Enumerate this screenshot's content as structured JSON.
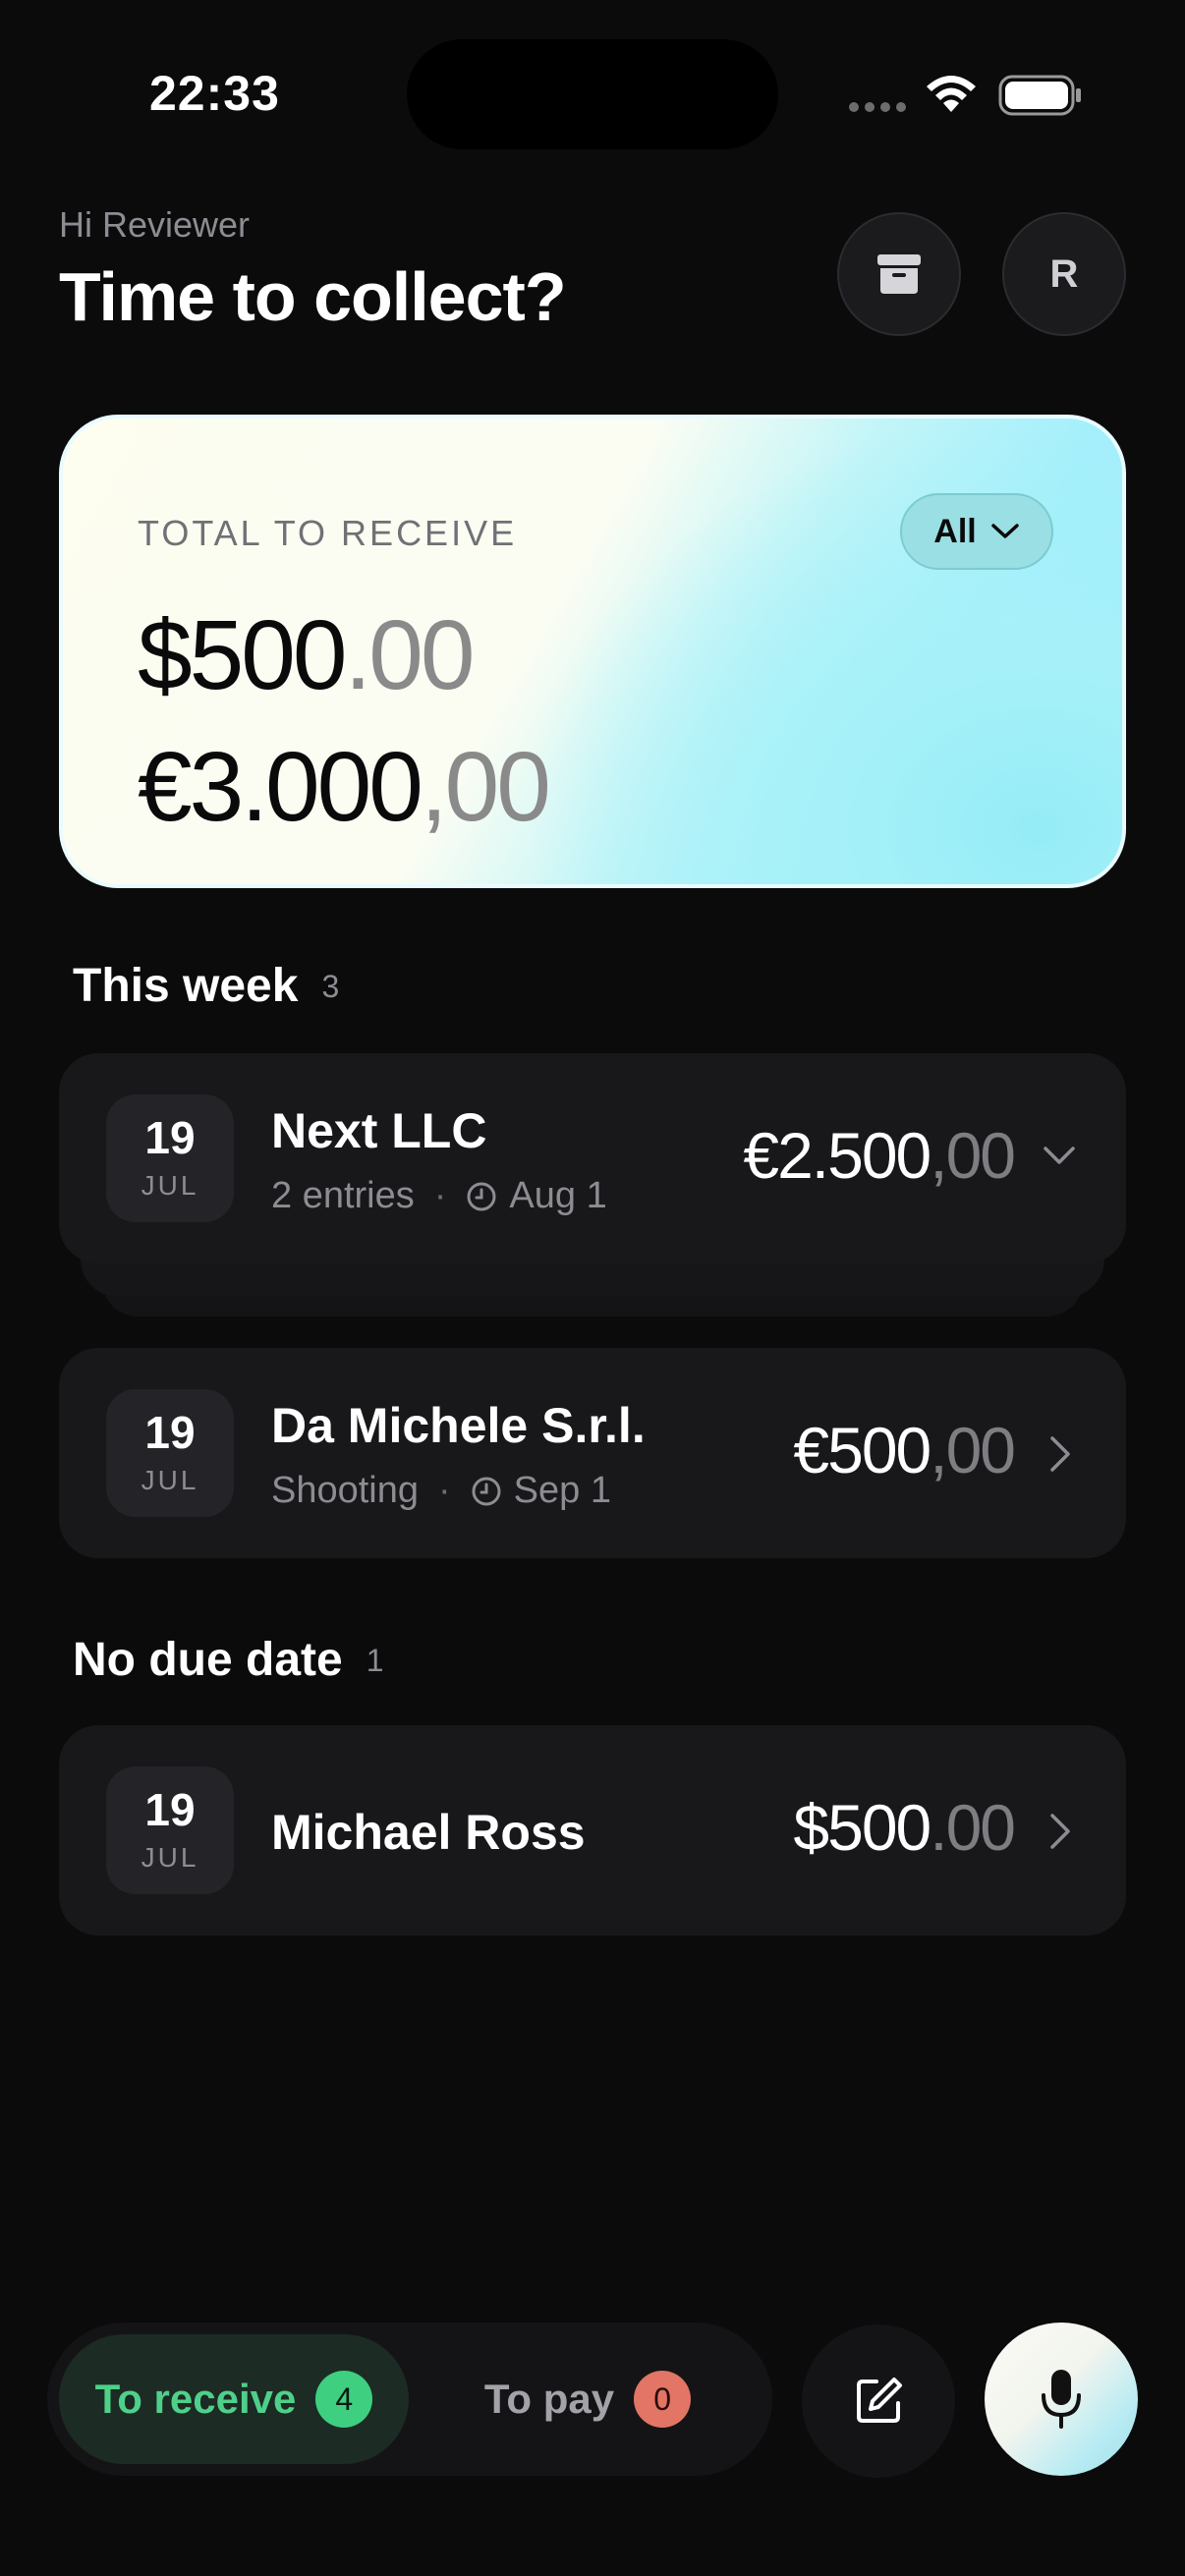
{
  "status_bar": {
    "time": "22:33"
  },
  "header": {
    "greeting": "Hi Reviewer",
    "title": "Time to collect?",
    "avatar_initial": "R"
  },
  "total_card": {
    "label": "TOTAL TO RECEIVE",
    "filter_label": "All",
    "amounts": [
      {
        "main": "$500",
        "decimal": ".00"
      },
      {
        "main": "€3.000",
        "decimal": ",00"
      }
    ]
  },
  "sections": [
    {
      "title": "This week",
      "count": "3",
      "rows": [
        {
          "day": "19",
          "month": "JUL",
          "name": "Next LLC",
          "sub": "2 entries",
          "due": "Aug 1",
          "amount_main": "€2.500",
          "amount_decimal": ",00",
          "chevron": "chevron-down-icon"
        },
        {
          "day": "19",
          "month": "JUL",
          "name": "Da Michele S.r.l.",
          "sub": "Shooting",
          "due": "Sep 1",
          "amount_main": "€500",
          "amount_decimal": ",00",
          "chevron": "chevron-right-icon"
        }
      ]
    },
    {
      "title": "No due date",
      "count": "1",
      "rows": [
        {
          "day": "19",
          "month": "JUL",
          "name": "Michael Ross",
          "amount_main": "$500",
          "amount_decimal": ".00",
          "chevron": "chevron-right-icon"
        }
      ]
    }
  ],
  "bottom_bar": {
    "tab_receive": {
      "label": "To receive",
      "count": "4"
    },
    "tab_pay": {
      "label": "To pay",
      "count": "0"
    },
    "icons": [
      "compose-icon",
      "microphone-icon"
    ]
  },
  "colors": {
    "background": "#0b0b0c",
    "accent_green": "#4fd08a",
    "badge_red": "#e27565",
    "card_cyan": "#9cedfa"
  }
}
